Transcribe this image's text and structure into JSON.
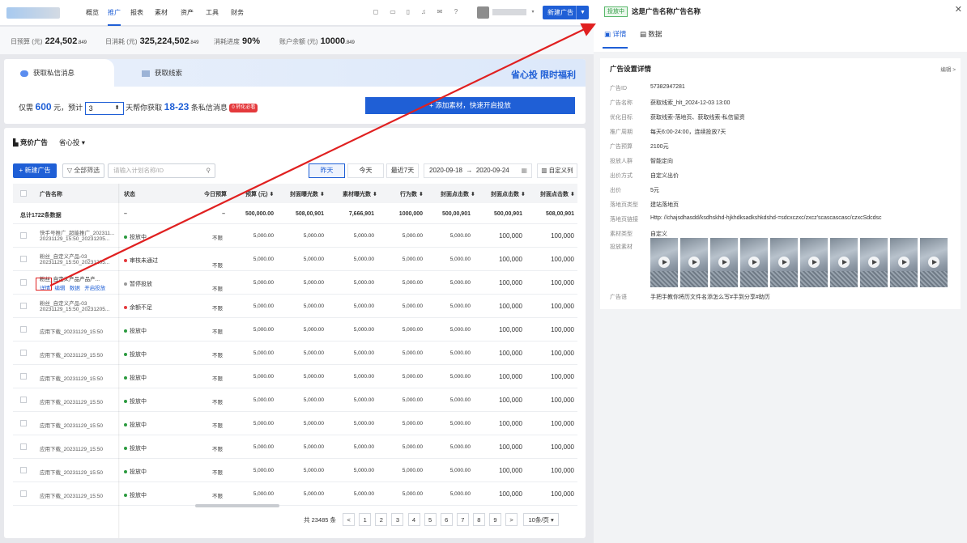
{
  "nav": {
    "items": [
      "概览",
      "推广",
      "报表",
      "素材",
      "资产",
      "工具",
      "财务"
    ],
    "active_index": 1,
    "new_ad_label": "新建广告"
  },
  "stats": [
    {
      "label": "日预算 (元)",
      "value": "224,502",
      "suffix": ".849"
    },
    {
      "label": "日消耗 (元)",
      "value": "325,224,502",
      "suffix": ".849"
    },
    {
      "label": "消耗进度",
      "value": "90%",
      "suffix": ""
    },
    {
      "label": "账户余额 (元)",
      "value": "10000",
      "suffix": ".849"
    }
  ],
  "promo": {
    "tab_active": "获取私信消息",
    "tab_inactive": "获取线索",
    "brand": "省心投",
    "brand_tag": "限时福利",
    "pre": "仅需",
    "amount": "600",
    "mid": "元，预计",
    "days": "3",
    "mid2": "天帮你获取",
    "range": "18-23",
    "post": "条私信消息",
    "badge": "0 转化必看",
    "cta": "+ 添加素材，快速开启投放"
  },
  "list": {
    "section_title": "竞价广告",
    "section_sub": "省心投",
    "new_button": "+ 新建广告",
    "filter_button": "全部筛选",
    "search_placeholder": "请输入计划名称/ID",
    "date_buttons": [
      "昨天",
      "今天",
      "最近7天"
    ],
    "date_active": 0,
    "date_start": "2020-09-18",
    "date_arrow": "→",
    "date_end": "2020-09-24",
    "custom_cols": "自定义列",
    "columns": [
      "广告名称",
      "状态",
      "今日预算",
      "预算 (元)",
      "封面曝光数",
      "素材曝光数",
      "行为数",
      "封面点击数",
      "封面点击数",
      "封面点击数"
    ],
    "total": {
      "name": "总计1722条数据",
      "status": "–",
      "today": "–",
      "budget": "500,000.00",
      "c1": "508,00,901",
      "c2": "7,666,901",
      "c3": "1000,000",
      "c4": "500,00,901",
      "c5": "500,00,901",
      "c6": "508,00,901"
    },
    "rows": [
      {
        "name1": "快手号推广_超能推广_202311...",
        "name2": "20231129_15:50_20231205...",
        "status": "投放中",
        "status_color": "#2b9a3f",
        "today": "不限",
        "budget": "5,000.00",
        "c1": "5,000.00",
        "c2": "5,000.00",
        "c3": "5,000.00",
        "c4": "5,000.00",
        "c5": "100,000",
        "c6": "100,000"
      },
      {
        "name1": "粉丝_自定义产品-03_",
        "name2": "20231129_15:50_20231205...",
        "status": "审核未通过",
        "status_color": "#e4393c",
        "today": "不限",
        "budget": "5,000.00",
        "c1": "5,000.00",
        "c2": "5,000.00",
        "c3": "5,000.00",
        "c4": "5,000.00",
        "c5": "100,000",
        "c6": "100,000"
      },
      {
        "name1": "粉丝_自定义产品产品产...",
        "name2": "",
        "status": "暂停投放",
        "status_color": "#999999",
        "today": "不限",
        "budget": "5,000.00",
        "c1": "5,000.00",
        "c2": "5,000.00",
        "c3": "5,000.00",
        "c4": "5,000.00",
        "c5": "100,000",
        "c6": "100,000",
        "actions": [
          "详情",
          "编辑",
          "数据",
          "开启投放"
        ]
      },
      {
        "name1": "粉丝_自定义产品-03_",
        "name2": "20231129_15:50_20231205...",
        "status": "余额不足",
        "status_color": "#e4393c",
        "today": "不限",
        "budget": "5,000.00",
        "c1": "5,000.00",
        "c2": "5,000.00",
        "c3": "5,000.00",
        "c4": "5,000.00",
        "c5": "100,000",
        "c6": "100,000"
      },
      {
        "name1": "应用下载_20231129_15:50",
        "name2": "",
        "status": "投放中",
        "status_color": "#2b9a3f",
        "today": "不限",
        "budget": "5,000.00",
        "c1": "5,000.00",
        "c2": "5,000.00",
        "c3": "5,000.00",
        "c4": "5,000.00",
        "c5": "100,000",
        "c6": "100,000"
      },
      {
        "name1": "应用下载_20231129_15:50",
        "name2": "",
        "status": "投放中",
        "status_color": "#2b9a3f",
        "today": "不限",
        "budget": "5,000.00",
        "c1": "5,000.00",
        "c2": "5,000.00",
        "c3": "5,000.00",
        "c4": "5,000.00",
        "c5": "100,000",
        "c6": "100,000"
      },
      {
        "name1": "应用下载_20231129_15:50",
        "name2": "",
        "status": "投放中",
        "status_color": "#2b9a3f",
        "today": "不限",
        "budget": "5,000.00",
        "c1": "5,000.00",
        "c2": "5,000.00",
        "c3": "5,000.00",
        "c4": "5,000.00",
        "c5": "100,000",
        "c6": "100,000"
      },
      {
        "name1": "应用下载_20231129_15:50",
        "name2": "",
        "status": "投放中",
        "status_color": "#2b9a3f",
        "today": "不限",
        "budget": "5,000.00",
        "c1": "5,000.00",
        "c2": "5,000.00",
        "c3": "5,000.00",
        "c4": "5,000.00",
        "c5": "100,000",
        "c6": "100,000"
      },
      {
        "name1": "应用下载_20231129_15:50",
        "name2": "",
        "status": "投放中",
        "status_color": "#2b9a3f",
        "today": "不限",
        "budget": "5,000.00",
        "c1": "5,000.00",
        "c2": "5,000.00",
        "c3": "5,000.00",
        "c4": "5,000.00",
        "c5": "100,000",
        "c6": "100,000"
      },
      {
        "name1": "应用下载_20231129_15:50",
        "name2": "",
        "status": "投放中",
        "status_color": "#2b9a3f",
        "today": "不限",
        "budget": "5,000.00",
        "c1": "5,000.00",
        "c2": "5,000.00",
        "c3": "5,000.00",
        "c4": "5,000.00",
        "c5": "100,000",
        "c6": "100,000"
      },
      {
        "name1": "应用下载_20231129_15:50",
        "name2": "",
        "status": "投放中",
        "status_color": "#2b9a3f",
        "today": "不限",
        "budget": "5,000.00",
        "c1": "5,000.00",
        "c2": "5,000.00",
        "c3": "5,000.00",
        "c4": "5,000.00",
        "c5": "100,000",
        "c6": "100,000"
      },
      {
        "name1": "应用下载_20231129_15:50",
        "name2": "",
        "status": "投放中",
        "status_color": "#2b9a3f",
        "today": "不限",
        "budget": "5,000.00",
        "c1": "5,000.00",
        "c2": "5,000.00",
        "c3": "5,000.00",
        "c4": "5,000.00",
        "c5": "100,000",
        "c6": "100,000"
      }
    ],
    "pagination": {
      "total_text": "共 23485 条",
      "prev": "<",
      "pages": [
        "1",
        "2",
        "3",
        "4",
        "5",
        "6",
        "7",
        "8",
        "9"
      ],
      "next": ">",
      "page_size": "10条/页"
    }
  },
  "detail": {
    "status_tag": "投放中",
    "title": "这是广告名称广告名称",
    "tabs": [
      "详情",
      "数据"
    ],
    "active_tab": 0,
    "card_title": "广告设置详情",
    "edit_label": "编辑 >",
    "fields": [
      {
        "label": "广告ID",
        "value": "57382947281"
      },
      {
        "label": "广告名称",
        "value": "获取线索_hlt_2024-12-03 13:00"
      },
      {
        "label": "优化目标",
        "value": "获取线索-落地页、获取线索-私信留资"
      },
      {
        "label": "推广周期",
        "value": "每天6:00-24:00，连续投放7天"
      },
      {
        "label": "广告预算",
        "value": "2100元"
      },
      {
        "label": "投放人群",
        "value": "智能定向"
      },
      {
        "label": "出价方式",
        "value": "自定义出价"
      },
      {
        "label": "出价",
        "value": "5元"
      },
      {
        "label": "落地页类型",
        "value": "建站落地页"
      },
      {
        "label": "落地页链接",
        "value": "Http: //chajsdhasdd/ksdhskhd-hjkhdksadkshkdshd-=sdcxczxc/zxcz'scascascasc/czxcSdcdsc"
      },
      {
        "label": "素材类型",
        "value": "自定义"
      },
      {
        "label": "投放素材",
        "value": ""
      }
    ],
    "material_count": 10,
    "copy_label": "广告语",
    "copy_value": "手把手教你将历文件名添怎么写#手到分享#助历"
  },
  "colors": {
    "primary": "#1f5fd6",
    "danger": "#e4393c",
    "success": "#2b9a3f",
    "arrow": "#e02020"
  }
}
